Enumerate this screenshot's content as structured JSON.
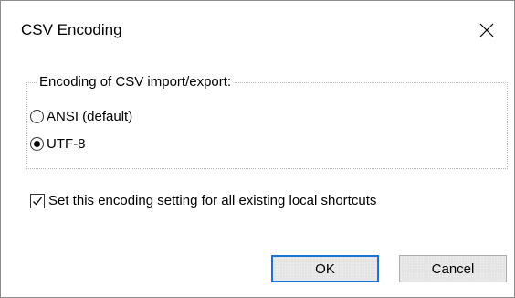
{
  "dialog": {
    "title": "CSV Encoding",
    "close_icon": "close-icon"
  },
  "encoding_group": {
    "legend": "Encoding of CSV import/export:",
    "options": [
      {
        "label": "ANSI (default)",
        "selected": false
      },
      {
        "label": "UTF-8",
        "selected": true
      }
    ]
  },
  "apply_all": {
    "label": "Set this encoding setting for all existing local shortcuts",
    "checked": true
  },
  "buttons": {
    "ok_label": "OK",
    "cancel_label": "Cancel"
  },
  "colors": {
    "default_button_border": "#1a73d8",
    "button_face": "#e5e5e5",
    "dialog_background": "#ffffff"
  }
}
